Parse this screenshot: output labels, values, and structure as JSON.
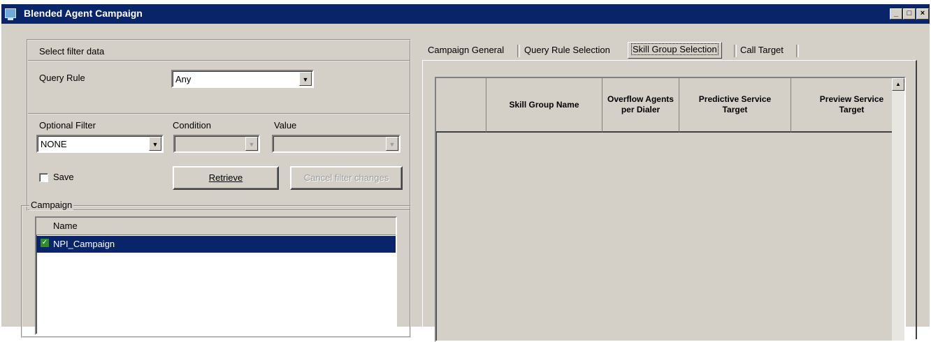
{
  "window": {
    "title": "Blended Agent Campaign",
    "controls": {
      "minimize": "_",
      "maximize": "□",
      "close": "×"
    }
  },
  "filter": {
    "group_label": "Select filter data",
    "query_rule_label": "Query Rule",
    "query_rule_value": "Any",
    "optional_filter_label": "Optional Filter",
    "optional_filter_value": "NONE",
    "condition_label": "Condition",
    "condition_value": "",
    "value_label": "Value",
    "value_value": "",
    "save_label": "Save",
    "save_checked": false,
    "retrieve_button": "Retrieve",
    "cancel_button": "Cancel filter changes"
  },
  "campaign": {
    "group_label": "Campaign",
    "column_name": "Name",
    "items": [
      {
        "name": "NPI_Campaign",
        "selected": true,
        "enabled": true
      }
    ]
  },
  "tabs": [
    {
      "label": "Campaign General",
      "active": false
    },
    {
      "label": "Query Rule Selection",
      "active": false
    },
    {
      "label": "Skill Group Selection",
      "active": true
    },
    {
      "label": "Call Target",
      "active": false
    }
  ],
  "skill_grid": {
    "columns": [
      "",
      "Skill Group Name",
      "Overflow Agents per Dialer",
      "Predictive Service Target",
      "Preview Service Target"
    ],
    "rows": []
  },
  "colors": {
    "titlebar": "#0a246a",
    "face": "#d4d0c8",
    "selection": "#0a246a",
    "check": "#2e8b2e"
  },
  "icons": [
    "app-icon",
    "minimize-icon",
    "maximize-icon",
    "close-icon",
    "checkmark-icon",
    "combo-arrow-icon",
    "scroll-up-icon"
  ]
}
